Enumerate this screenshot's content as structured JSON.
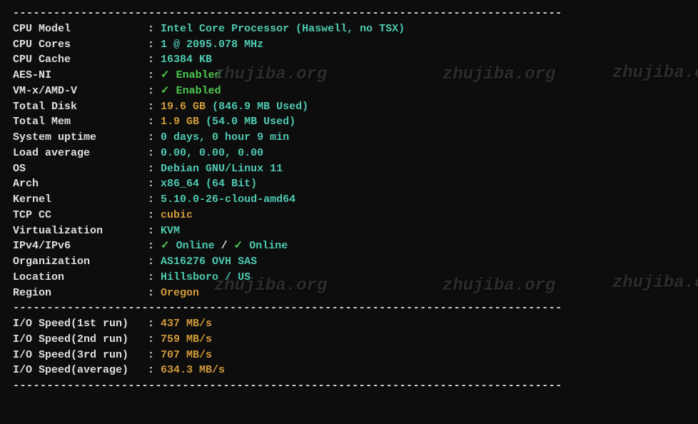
{
  "watermark": "zhujiba.org",
  "dashes": "---------------------------------------------------------------------------------",
  "sysinfo": {
    "cpu_model": {
      "label": "CPU Model",
      "value": "Intel Core Processor (Haswell, no TSX)"
    },
    "cpu_cores": {
      "label": "CPU Cores",
      "value": "1 @ 2095.078 MHz"
    },
    "cpu_cache": {
      "label": "CPU Cache",
      "value": "16384 KB"
    },
    "aes_ni": {
      "label": "AES-NI",
      "check": "✓ ",
      "value": "Enabled"
    },
    "vmx": {
      "label": "VM-x/AMD-V",
      "check": "✓ ",
      "value": "Enabled"
    },
    "total_disk": {
      "label": "Total Disk",
      "value": "19.6 GB",
      "used": " (846.9 MB Used)"
    },
    "total_mem": {
      "label": "Total Mem",
      "value": "1.9 GB",
      "used": " (54.0 MB Used)"
    },
    "uptime": {
      "label": "System uptime",
      "value": "0 days, 0 hour 9 min"
    },
    "loadavg": {
      "label": "Load average",
      "value": "0.00, 0.00, 0.00"
    },
    "os": {
      "label": "OS",
      "value": "Debian GNU/Linux 11"
    },
    "arch": {
      "label": "Arch",
      "value": "x86_64 (64 Bit)"
    },
    "kernel": {
      "label": "Kernel",
      "value": "5.10.0-26-cloud-amd64"
    },
    "tcpcc": {
      "label": "TCP CC",
      "value": "cubic"
    },
    "virt": {
      "label": "Virtualization",
      "value": "KVM"
    },
    "ipv": {
      "label": "IPv4/IPv6",
      "check1": "✓ ",
      "v1": "Online",
      "sep": " / ",
      "check2": "✓ ",
      "v2": "Online"
    },
    "org": {
      "label": "Organization",
      "value": "AS16276 OVH SAS"
    },
    "location": {
      "label": "Location",
      "value": "Hillsboro / US"
    },
    "region": {
      "label": "Region",
      "value": "Oregon"
    }
  },
  "io": {
    "run1": {
      "label": "I/O Speed(1st run)",
      "value": "437 MB/s"
    },
    "run2": {
      "label": "I/O Speed(2nd run)",
      "value": "759 MB/s"
    },
    "run3": {
      "label": "I/O Speed(3rd run)",
      "value": "707 MB/s"
    },
    "avg": {
      "label": "I/O Speed(average)",
      "value": "634.3 MB/s"
    }
  }
}
